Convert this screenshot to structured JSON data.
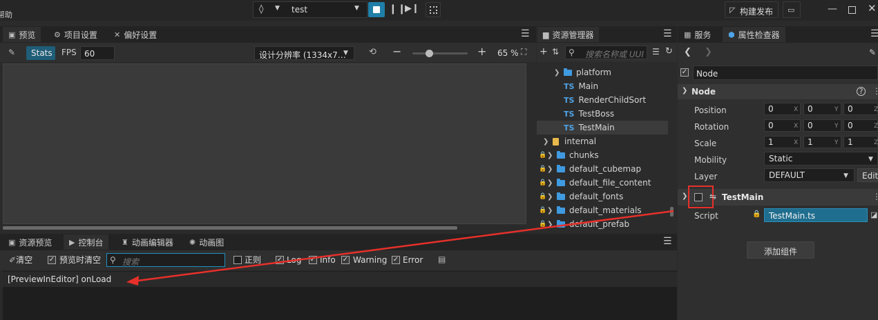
{
  "topbar": {
    "cut_label": "帮助",
    "scene_select": "test",
    "build_label": "构建发布"
  },
  "preview_panel": {
    "tabs": [
      "预览",
      "项目设置",
      "偏好设置"
    ],
    "stats_label": "Stats",
    "fps_label": "FPS",
    "fps_value": "60",
    "resolution": "设计分辨率 (1334x7…",
    "zoom": "65 %"
  },
  "bottom_panel": {
    "tabs": [
      "资源预览",
      "控制台",
      "动画编辑器",
      "动画图"
    ],
    "clear_label": "清空",
    "clear_on_preview": "预览时清空",
    "search_placeholder": "搜索",
    "regex_label": "正则",
    "filters": [
      "Log",
      "Info",
      "Warning",
      "Error"
    ],
    "log_line": "[PreviewInEditor] onLoad"
  },
  "assets": {
    "tab": "资源管理器",
    "search_placeholder": "搜索名称或 UUI",
    "items": [
      {
        "type": "folder",
        "name": "platform",
        "locked": false,
        "indent": 1
      },
      {
        "type": "ts",
        "name": "Main",
        "locked": false,
        "indent": 1
      },
      {
        "type": "ts",
        "name": "RenderChildSort",
        "locked": false,
        "indent": 1
      },
      {
        "type": "ts",
        "name": "TestBoss",
        "locked": false,
        "indent": 1
      },
      {
        "type": "ts",
        "name": "TestMain",
        "locked": false,
        "indent": 1,
        "selected": true
      },
      {
        "type": "db",
        "name": "internal",
        "locked": false,
        "indent": 0
      },
      {
        "type": "folder",
        "name": "chunks",
        "locked": true,
        "indent": 0
      },
      {
        "type": "folder",
        "name": "default_cubemap",
        "locked": true,
        "indent": 0
      },
      {
        "type": "folder",
        "name": "default_file_content",
        "locked": true,
        "indent": 0
      },
      {
        "type": "folder",
        "name": "default_fonts",
        "locked": true,
        "indent": 0
      },
      {
        "type": "folder",
        "name": "default_materials",
        "locked": true,
        "indent": 0
      },
      {
        "type": "folder",
        "name": "default_prefab",
        "locked": true,
        "indent": 0
      }
    ]
  },
  "inspector": {
    "tabs": [
      "服务",
      "属性检查器"
    ],
    "node_name": "Node",
    "section_node": "Node",
    "position": {
      "label": "Position",
      "x": "0",
      "y": "0",
      "z": "0"
    },
    "rotation": {
      "label": "Rotation",
      "x": "0",
      "y": "0",
      "z": "0"
    },
    "scale": {
      "label": "Scale",
      "x": "1",
      "y": "1",
      "z": "1"
    },
    "axis": {
      "x": "X",
      "y": "Y",
      "z": "Z"
    },
    "mobility": {
      "label": "Mobility",
      "value": "Static"
    },
    "layer": {
      "label": "Layer",
      "value": "DEFAULT",
      "edit": "Edit"
    },
    "component_name": "TestMain",
    "script_label": "Script",
    "script_value": "TestMain.ts",
    "add_component": "添加组件"
  },
  "colors": {
    "accent": "#1f7fa8",
    "highlight_red": "#e8302a"
  }
}
